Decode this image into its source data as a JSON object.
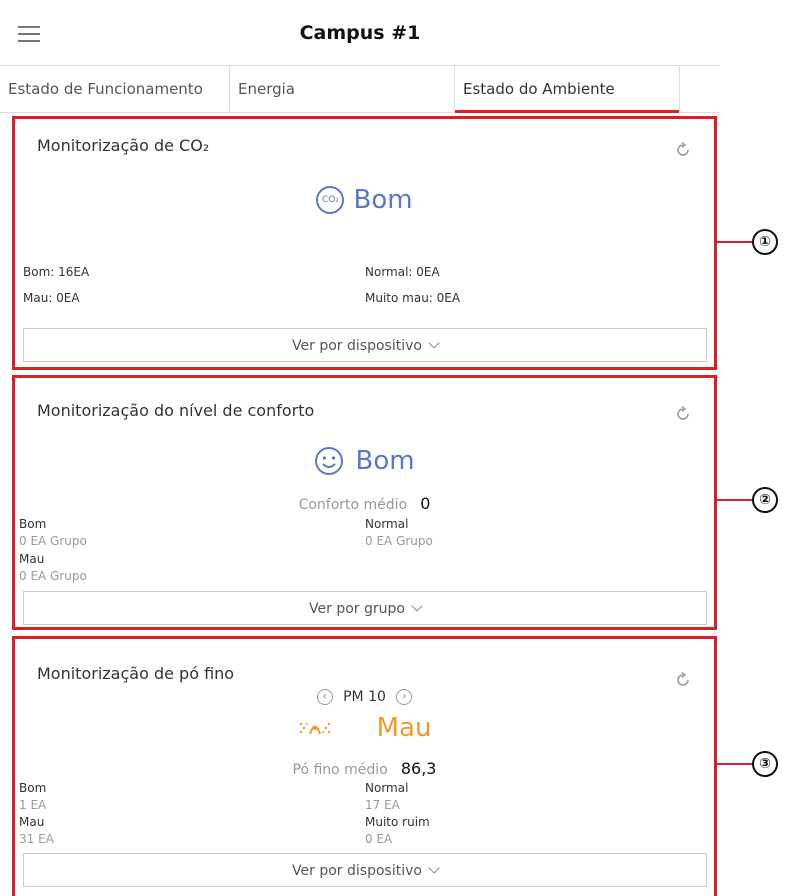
{
  "header": {
    "title": "Campus #1"
  },
  "tabs": [
    {
      "label": "Estado de Funcionamento"
    },
    {
      "label": "Energia"
    },
    {
      "label": "Estado do Ambiente"
    }
  ],
  "co2": {
    "title": "Monitorização de CO₂",
    "status": "Bom",
    "icon_text": "CO₂",
    "stats": {
      "good": "Bom: 16EA",
      "normal": "Normal: 0EA",
      "bad": "Mau: 0EA",
      "very_bad": "Muito mau: 0EA"
    },
    "button": "Ver por dispositivo"
  },
  "comfort": {
    "title": "Monitorização do nível de conforto",
    "status": "Bom",
    "avg_label": "Conforto médio",
    "avg_value": "0",
    "good_label": "Bom",
    "good_value": "0 EA Grupo",
    "normal_label": "Normal",
    "normal_value": "0 EA Grupo",
    "bad_label": "Mau",
    "bad_value": "0 EA Grupo",
    "button": "Ver por grupo"
  },
  "dust": {
    "title": "Monitorização de pó fino",
    "selector": "PM 10",
    "status": "Mau",
    "avg_label": "Pó fino médio",
    "avg_value": "86,3",
    "good_label": "Bom",
    "good_value": "1 EA",
    "normal_label": "Normal",
    "normal_value": "17 EA",
    "bad_label": "Mau",
    "bad_value": "31 EA",
    "very_bad_label": "Muito ruim",
    "very_bad_value": "0 EA",
    "button": "Ver por dispositivo"
  },
  "callouts": [
    "①",
    "②",
    "③"
  ],
  "colors": {
    "accent": "#d91f26",
    "good": "#5b77c6",
    "bad": "#f09a2a"
  }
}
